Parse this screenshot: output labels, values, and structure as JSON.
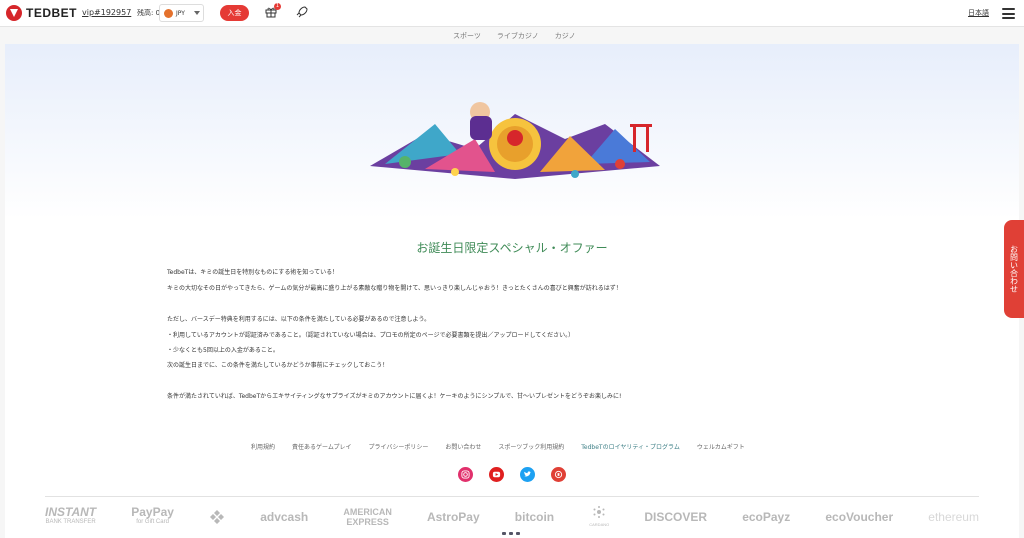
{
  "header": {
    "logo_text": "TEDBET",
    "user": "vip#192957",
    "balance_label": "残高: 0",
    "currency": "JPY",
    "deposit_label": "入金",
    "gift_badge": "1",
    "language": "日本語"
  },
  "tabs": [
    {
      "label": "スポーツ"
    },
    {
      "label": "ライブカジノ"
    },
    {
      "label": "カジノ"
    }
  ],
  "offer": {
    "title": "お誕生日限定スペシャル・オファー",
    "p1": "TedbeTは、キミの誕生日を特別なものにする術を知っている！",
    "p2": "キミの大切なその日がやってきたら、ゲームの気分が最高に盛り上がる素敵な贈り物を開けて、思いっきり楽しんじゃおう！きっとたくさんの喜びと興奮が訪れるはず！",
    "p3": "ただし、バースデー特典を利用するには、以下の条件を満たしている必要があるので注意しよう。",
    "p4": "・利用しているアカウントが認証済みであること。（認証されていない場合は、プロモの所定のページで必要書類を提出／アップロードしてください。）",
    "p5": "・少なくとも5回以上の入金があること。",
    "p6": "次の誕生日までに、この条件を満たしているかどうか事前にチェックしておこう！",
    "p7": "条件が満たされていれば、TedbeTからエキサイティングなサプライズがキミのアカウントに届くよ！ケーキのようにシンプルで、甘〜いプレゼントをどうぞお楽しみに!"
  },
  "footer_links": [
    {
      "label": "利用規約"
    },
    {
      "label": "責任あるゲームプレイ"
    },
    {
      "label": "プライバシーポリシー"
    },
    {
      "label": "お問い合わせ"
    },
    {
      "label": "スポーツブック利用規約"
    },
    {
      "label": "TedbeTのロイヤリティ・プログラム"
    },
    {
      "label": "ウェルカムギフト"
    }
  ],
  "socials": [
    {
      "icon": "instagram-icon",
      "color": "#e1306c"
    },
    {
      "icon": "youtube-icon",
      "color": "#e02020"
    },
    {
      "icon": "twitter-icon",
      "color": "#1da1f2"
    },
    {
      "icon": "blog-icon",
      "color": "#e04036"
    }
  ],
  "payments": {
    "instant": "INSTANT",
    "instant_sub": "BANK TRANSFER",
    "paypay": "PayPay",
    "paypay_sub": "for Gift Card",
    "advcash": "advcash",
    "amex": "AMERICAN",
    "amex_sub": "EXPRESS",
    "astropay": "AstroPay",
    "bitcoin": "bitcoin",
    "cardano_sub": "CARDANO",
    "discover": "DISCOVER",
    "ecopayz": "ecoPayz",
    "ecovoucher": "ecoVoucher",
    "ethereum": "ethereum"
  },
  "contact_label": "お問い合わせ",
  "colors": {
    "brand_red": "#e53a35",
    "title_green": "#3f8b57",
    "link_teal": "#3d7f86"
  }
}
